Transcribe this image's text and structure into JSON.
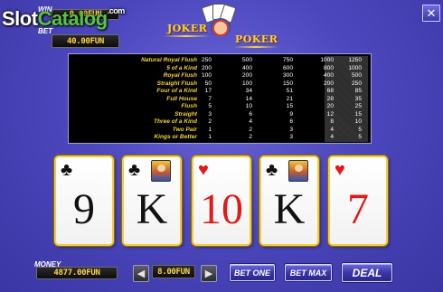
{
  "header": {
    "win_label": "WIN",
    "win_value": "0.00FUN",
    "bet_label": "BET",
    "bet_value": "40.00FUN",
    "watermark": {
      "slot": "Slot",
      "catalog": "Catalog",
      "com": ".com"
    },
    "logo": {
      "joker": "JOKER",
      "poker": "POKER"
    },
    "close_icon": "x-icon"
  },
  "paytable": {
    "rows": [
      {
        "hand": "Natural Royal Flush",
        "values": [
          "250",
          "500",
          "750",
          "1000",
          "1250"
        ]
      },
      {
        "hand": "5 of a Kind",
        "values": [
          "200",
          "400",
          "600",
          "800",
          "1000"
        ]
      },
      {
        "hand": "Royal Flush",
        "values": [
          "100",
          "200",
          "300",
          "400",
          "500"
        ]
      },
      {
        "hand": "Straight Flush",
        "values": [
          "50",
          "100",
          "150",
          "200",
          "250"
        ]
      },
      {
        "hand": "Four of a Kind",
        "values": [
          "17",
          "34",
          "51",
          "68",
          "85"
        ]
      },
      {
        "hand": "Full House",
        "values": [
          "7",
          "14",
          "21",
          "28",
          "35"
        ]
      },
      {
        "hand": "Flush",
        "values": [
          "5",
          "10",
          "15",
          "20",
          "25"
        ]
      },
      {
        "hand": "Straight",
        "values": [
          "3",
          "6",
          "9",
          "12",
          "15"
        ]
      },
      {
        "hand": "Three of a Kind",
        "values": [
          "2",
          "4",
          "6",
          "8",
          "10"
        ]
      },
      {
        "hand": "Two Pair",
        "values": [
          "1",
          "2",
          "3",
          "4",
          "5"
        ]
      },
      {
        "hand": "Kings or Better",
        "values": [
          "1",
          "2",
          "3",
          "4",
          "5"
        ]
      }
    ],
    "highlighted_column": 5
  },
  "cards": [
    {
      "rank": "9",
      "suit": "♣",
      "color": "#111111",
      "face_art": false
    },
    {
      "rank": "K",
      "suit": "♣",
      "color": "#111111",
      "face_art": true
    },
    {
      "rank": "10",
      "suit": "♥",
      "color": "#e21919",
      "face_art": false
    },
    {
      "rank": "K",
      "suit": "♣",
      "color": "#111111",
      "face_art": true
    },
    {
      "rank": "7",
      "suit": "♥",
      "color": "#e21919",
      "face_art": false
    }
  ],
  "footer": {
    "money_label": "MONEY",
    "money_value": "4877.00FUN",
    "bet_amount": "8.00FUN",
    "decrease_icon": "left-arrow-icon",
    "increase_icon": "right-arrow-icon",
    "bet_one_label": "BET ONE",
    "bet_max_label": "BET MAX",
    "deal_label": "DEAL"
  }
}
